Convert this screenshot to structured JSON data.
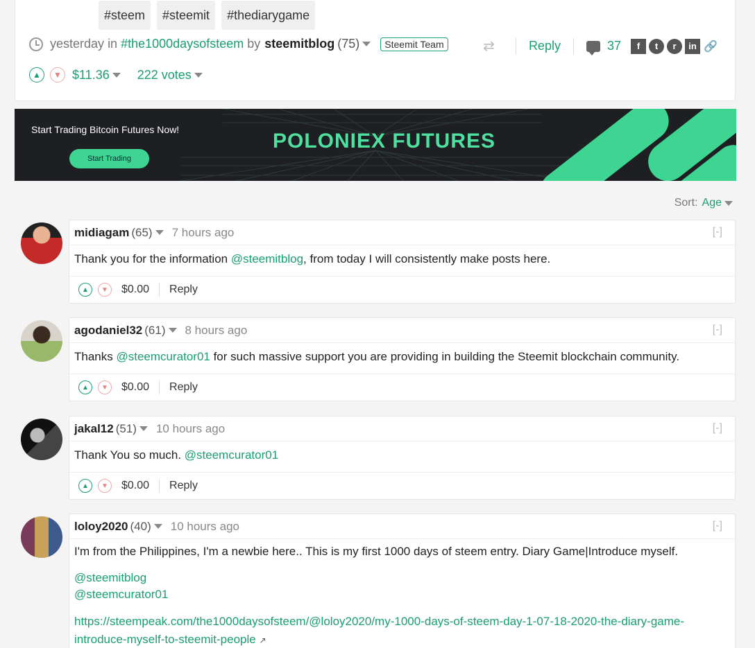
{
  "post": {
    "tags": [
      "#steem",
      "#steemit",
      "#thediarygame"
    ],
    "time": "yesterday",
    "in_word": "in",
    "community": "#the1000daysofsteem",
    "by_word": "by",
    "author": "steemitblog",
    "reputation": "(75)",
    "badge": "Steemit Team",
    "reply_label": "Reply",
    "comment_count": "37",
    "payout": "$11.36",
    "votes": "222 votes"
  },
  "ad": {
    "tagline": "Start Trading Bitcoin Futures Now!",
    "button": "Start Trading",
    "title": "POLONIEX FUTURES"
  },
  "sort": {
    "label": "Sort:",
    "value": "Age"
  },
  "comments": [
    {
      "author": "midiagam",
      "reputation": "(65)",
      "time": "7 hours ago",
      "collapse": "[-]",
      "pre": "Thank you for the information ",
      "mention": "@steemitblog",
      "post": ", from today I will consistently make posts here.",
      "payout": "$0.00",
      "reply": "Reply"
    },
    {
      "author": "agodaniel32",
      "reputation": "(61)",
      "time": "8 hours ago",
      "collapse": "[-]",
      "pre": "Thanks ",
      "mention": "@steemcurator01",
      "post": " for such massive support you are providing in building the Steemit blockchain community.",
      "payout": "$0.00",
      "reply": "Reply"
    },
    {
      "author": "jakal12",
      "reputation": "(51)",
      "time": "10 hours ago",
      "collapse": "[-]",
      "pre": "Thank You so much. ",
      "mention": "@steemcurator01",
      "post": "",
      "payout": "$0.00",
      "reply": "Reply"
    },
    {
      "author": "loloy2020",
      "reputation": "(40)",
      "time": "10 hours ago",
      "collapse": "[-]",
      "text": "I'm from the Philippines, I'm a newbie here.. This is my first 1000 days of steem entry. Diary Game|Introduce myself.",
      "mention1": "@steemitblog",
      "mention2": "@steemcurator01",
      "url": "https://steempeak.com/the1000daysofsteem/@loloy2020/my-1000-days-of-steem-day-1-07-18-2020-the-diary-game-introduce-myself-to-steemit-people"
    }
  ],
  "colors": {
    "accent": "#1a9e6e",
    "downvote": "#e58080",
    "ad_green": "#3ed593"
  }
}
